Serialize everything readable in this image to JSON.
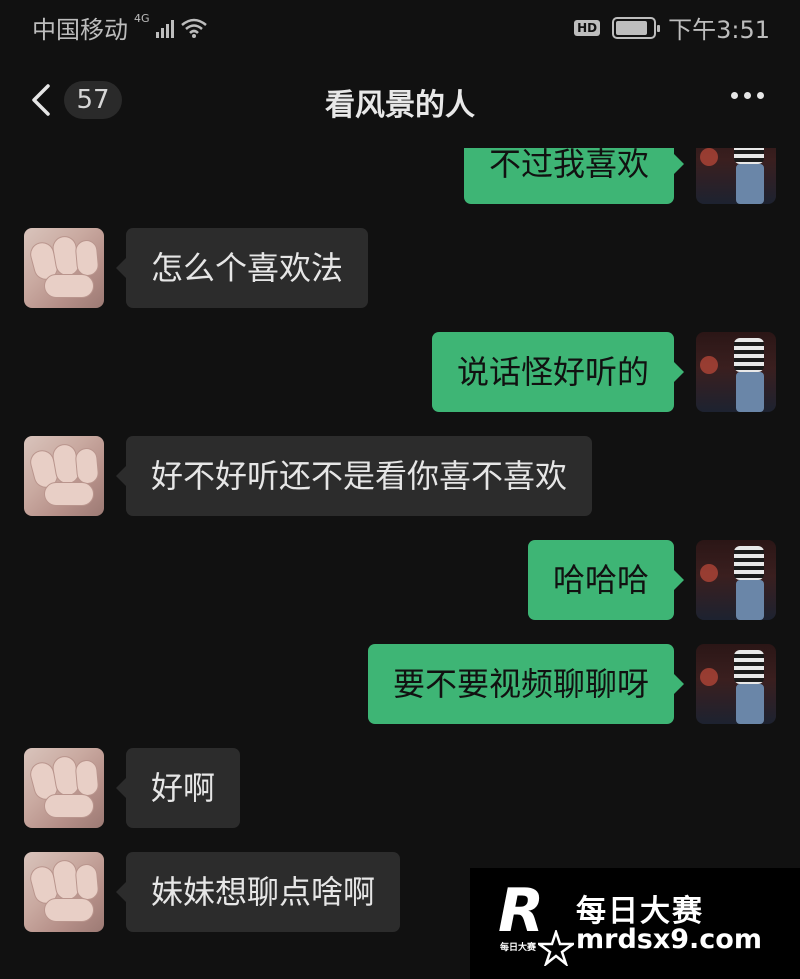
{
  "status_bar": {
    "carrier": "中国移动",
    "network": "4G",
    "hd_badge": "HD",
    "time": "下午3:51",
    "battery_level": 0.85
  },
  "nav": {
    "unread_count": "57",
    "title": "看风景的人",
    "back_icon": "chevron-left-icon",
    "more_icon": "more-dots-icon"
  },
  "colors": {
    "background": "#111111",
    "sent_bubble": "#3eb575",
    "received_bubble": "#2c2c2c"
  },
  "messages": [
    {
      "direction": "sent",
      "text": "不过我喜欢"
    },
    {
      "direction": "received",
      "text": "怎么个喜欢法"
    },
    {
      "direction": "sent",
      "text": "说话怪好听的"
    },
    {
      "direction": "received",
      "text": "好不好听还不是看你喜不喜欢"
    },
    {
      "direction": "sent",
      "text": "哈哈哈"
    },
    {
      "direction": "sent",
      "text": "要不要视频聊聊呀"
    },
    {
      "direction": "received",
      "text": "好啊"
    },
    {
      "direction": "received",
      "text": "妹妹想聊点啥啊"
    }
  ],
  "watermark": {
    "logo_letter": "R",
    "logo_caption": "每日大赛",
    "title": "每日大赛",
    "url": "mrdsx9.com"
  }
}
